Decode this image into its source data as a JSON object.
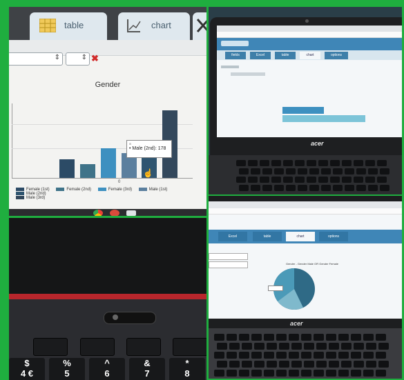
{
  "top_left": {
    "tabs": [
      {
        "label": "table"
      },
      {
        "label": "chart"
      }
    ],
    "chart_title": "Gender",
    "tooltip": "• Male (2nd): 178",
    "legend": [
      "Female (1st)",
      "Female (2nd)",
      "Female (3rd)",
      "Male (1st)",
      "Male (2nd)",
      "Male (3rd)"
    ],
    "colors": [
      "#2c4b66",
      "#3f7389",
      "#3d90c0",
      "#5b7f9e",
      "#2f5570",
      "#33485c"
    ],
    "zero_label": "0"
  },
  "top_right": {
    "brand": "acer",
    "app_tabs": [
      "fields",
      "Excel",
      "table",
      "chart",
      "options"
    ]
  },
  "bottom_right": {
    "brand": "acer",
    "app_tabs": [
      "Excel",
      "table",
      "chart",
      "options"
    ],
    "chart_title": "Gender - Gender Male OR Gender Female"
  },
  "bottom_left": {
    "number_keys": [
      "$\n4 €",
      "%\n5",
      "^\n6",
      "&\n7",
      "*\n8"
    ]
  }
}
